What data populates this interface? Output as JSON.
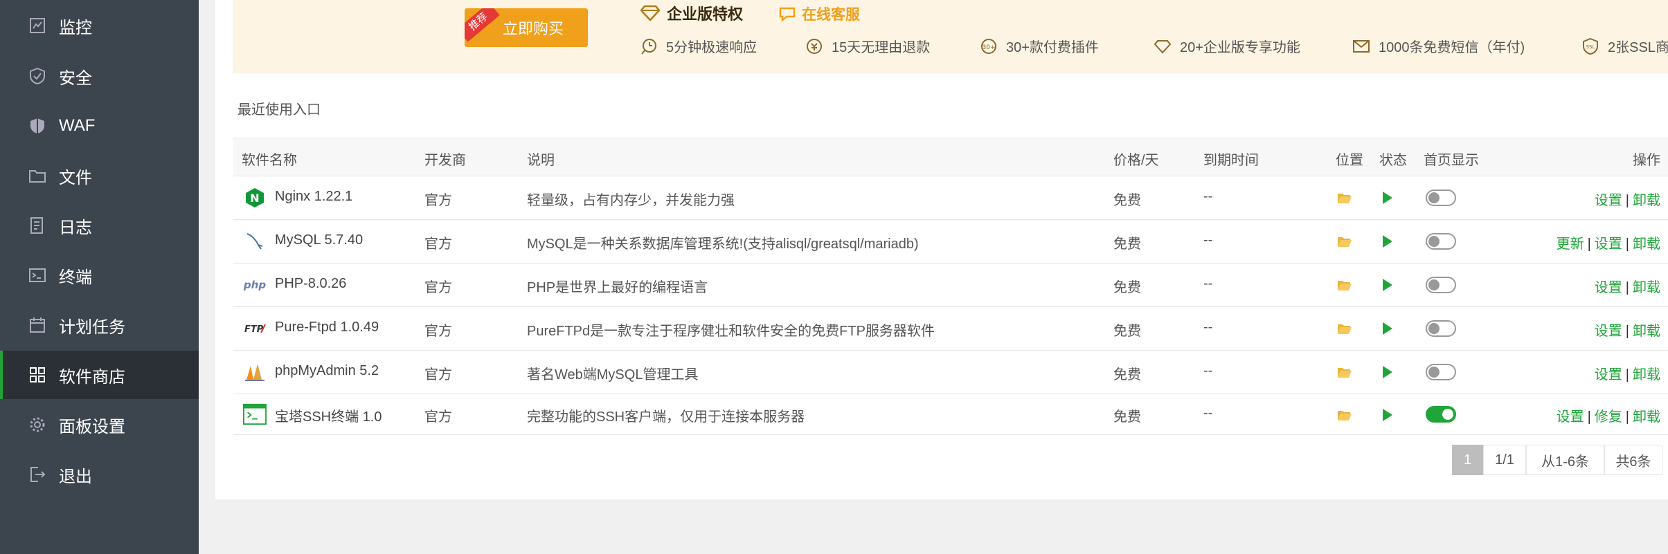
{
  "sidebar": {
    "items": [
      {
        "label": "监控",
        "icon": "monitor-icon"
      },
      {
        "label": "安全",
        "icon": "shield-icon"
      },
      {
        "label": "WAF",
        "icon": "waf-icon"
      },
      {
        "label": "文件",
        "icon": "folder-icon"
      },
      {
        "label": "日志",
        "icon": "log-icon"
      },
      {
        "label": "终端",
        "icon": "terminal-icon"
      },
      {
        "label": "计划任务",
        "icon": "calendar-icon"
      },
      {
        "label": "软件商店",
        "icon": "grid-icon",
        "active": true
      },
      {
        "label": "面板设置",
        "icon": "gear-icon"
      },
      {
        "label": "退出",
        "icon": "logout-icon"
      }
    ]
  },
  "banner": {
    "ribbon": "推荐",
    "buy_label": "立即购买",
    "enterprise_title": "企业版特权",
    "online_service": "在线客服",
    "features": [
      "5分钟极速响应",
      "15天无理由退款",
      "30+款付费插件",
      "20+企业版专享功能",
      "1000条免费短信（年付)",
      "2张SSL商"
    ]
  },
  "recent_label": "最近使用入口",
  "table": {
    "headers": {
      "name": "软件名称",
      "developer": "开发商",
      "description": "说明",
      "price": "价格/天",
      "expire": "到期时间",
      "location": "位置",
      "status": "状态",
      "homepage": "首页显示",
      "actions": "操作"
    },
    "rows": [
      {
        "name": "Nginx 1.22.1",
        "developer": "官方",
        "description": "轻量级，占有内存少，并发能力强",
        "price": "免费",
        "expire": "--",
        "homepage_on": false,
        "actions": [
          "设置",
          "卸载"
        ],
        "icon": "nginx-icon"
      },
      {
        "name": "MySQL 5.7.40",
        "developer": "官方",
        "description": "MySQL是一种关系数据库管理系统!(支持alisql/greatsql/mariadb)",
        "price": "免费",
        "expire": "--",
        "homepage_on": false,
        "actions": [
          "更新",
          "设置",
          "卸载"
        ],
        "icon": "mysql-icon"
      },
      {
        "name": "PHP-8.0.26",
        "developer": "官方",
        "description": "PHP是世界上最好的编程语言",
        "price": "免费",
        "expire": "--",
        "homepage_on": false,
        "actions": [
          "设置",
          "卸载"
        ],
        "icon": "php-icon"
      },
      {
        "name": "Pure-Ftpd 1.0.49",
        "developer": "官方",
        "description": "PureFTPd是一款专注于程序健壮和软件安全的免费FTP服务器软件",
        "price": "免费",
        "expire": "--",
        "homepage_on": false,
        "actions": [
          "设置",
          "卸载"
        ],
        "icon": "ftp-icon"
      },
      {
        "name": "phpMyAdmin 5.2",
        "developer": "官方",
        "description": "著名Web端MySQL管理工具",
        "price": "免费",
        "expire": "--",
        "homepage_on": false,
        "actions": [
          "设置",
          "卸载"
        ],
        "icon": "phpmyadmin-icon"
      },
      {
        "name": "宝塔SSH终端 1.0",
        "developer": "官方",
        "description": "完整功能的SSH客户端，仅用于连接本服务器",
        "price": "免费",
        "expire": "--",
        "homepage_on": true,
        "actions": [
          "设置",
          "修复",
          "卸载"
        ],
        "icon": "ssh-terminal-icon"
      }
    ]
  },
  "pagination": {
    "current": "1",
    "pages": "1/1",
    "range": "从1-6条",
    "total": "共6条"
  },
  "colors": {
    "sidebar_bg": "#3c444d",
    "accent_green": "#20a53a",
    "buy_orange": "#f0a01a",
    "banner_bg": "#fdf4e3"
  }
}
